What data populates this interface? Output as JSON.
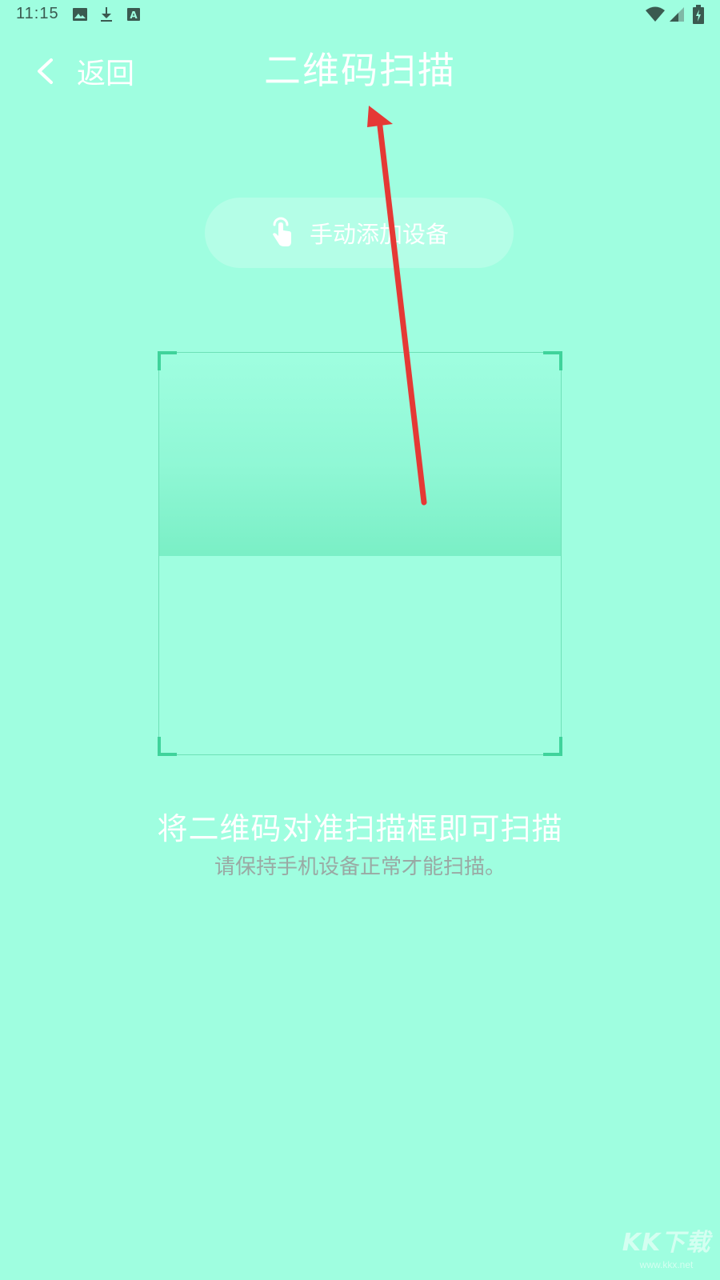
{
  "status_bar": {
    "time": "11:15",
    "icons_left": [
      "image-icon",
      "download-icon",
      "a-box-icon"
    ],
    "icons_right": [
      "wifi-icon",
      "signal-icon",
      "battery-charging-icon"
    ]
  },
  "header": {
    "back_label": "返回",
    "title": "二维码扫描"
  },
  "manual_add": {
    "icon": "tap-hand-icon",
    "label": "手动添加设备"
  },
  "scanner": {
    "corner_color": "#3fd39b"
  },
  "hints": {
    "main": "将二维码对准扫描框即可扫描",
    "sub": "请保持手机设备正常才能扫描。"
  },
  "annotation": {
    "type": "arrow",
    "color": "#e53935"
  },
  "watermark": {
    "logo": "KK下载",
    "url": "www.kkx.net"
  },
  "colors": {
    "background": "#9ffee0",
    "text_primary": "#ffffff",
    "text_secondary": "#9aa9a4",
    "accent": "#3fd39b"
  }
}
